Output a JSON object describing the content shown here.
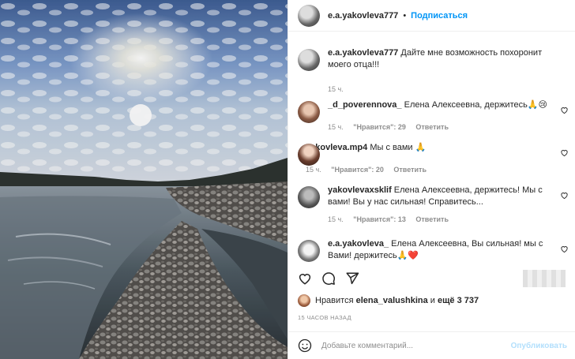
{
  "post": {
    "author": "e.a.yakovleva777",
    "follow_label": "Подписаться",
    "dot": "•"
  },
  "comments": [
    {
      "user": "e.a.yakovleva777",
      "text": "Дайте мне возможность похоронит моего отца!!!",
      "time": "15 ч.",
      "likes": "",
      "reply": ""
    },
    {
      "user": "_d_poverennova_",
      "text": "Елена Алексеевна, держитесь🙏😢",
      "time": "15 ч.",
      "likes": "\"Нравится\": 29",
      "reply": "Ответить"
    },
    {
      "user": "yakovleva.mp4",
      "text": "Мы с вами 🙏",
      "time": "15 ч.",
      "likes": "\"Нравится\": 20",
      "reply": "Ответить"
    },
    {
      "user": "yakovlevaxsklif",
      "text": "Елена Алексеевна, держитесь! Мы с вами! Вы у нас сильная! Справитесь...",
      "time": "15 ч.",
      "likes": "\"Нравится\": 13",
      "reply": "Ответить"
    },
    {
      "user": "e.a.yakovleva_",
      "text": "Елена Алексеевна, Вы сильная! мы с Вами! держитесь🙏❤️",
      "time": "",
      "likes": "",
      "reply": ""
    }
  ],
  "likes": {
    "prefix": "Нравится",
    "user": "elena_valushkina",
    "middle": "и",
    "rest": "ещё 3 737"
  },
  "timestamp": "15 ЧАСОВ НАЗАД",
  "add_comment": {
    "placeholder": "Добавьте комментарий...",
    "publish_label": "Опубликовать"
  },
  "colors": {
    "accent": "#0095f6",
    "publish_disabled": "#b2dffc",
    "meta": "#8e8e8e"
  },
  "icons": [
    "heart-icon",
    "comment-icon",
    "share-icon",
    "emoji-icon"
  ]
}
